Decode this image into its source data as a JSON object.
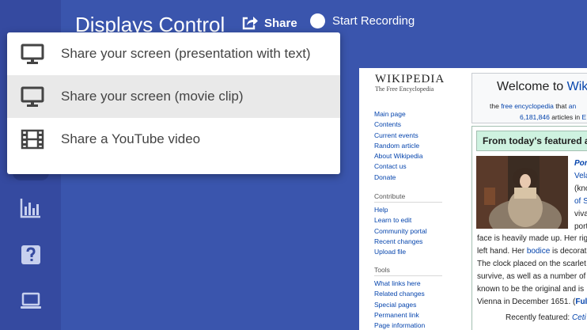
{
  "header": {
    "title": "Displays Control",
    "share_label": "Share",
    "recording_label": "Start Recording"
  },
  "sidebar": {
    "items": [
      {
        "icon": "bar-chart-icon"
      },
      {
        "icon": "help-icon"
      },
      {
        "icon": "laptop-icon"
      }
    ]
  },
  "share_menu": {
    "items": [
      {
        "label": "Share your screen (presentation with text)",
        "icon": "monitor-icon",
        "active": false
      },
      {
        "label": "Share your screen (movie clip)",
        "icon": "monitor-icon",
        "active": true
      },
      {
        "label": "Share a YouTube video",
        "icon": "film-icon",
        "active": false
      }
    ]
  },
  "preview": {
    "logo_name": "WIKIPEDIA",
    "logo_tagline": "The Free Encyclopedia",
    "nav_main": [
      "Main page",
      "Contents",
      "Current events",
      "Random article",
      "About Wikipedia",
      "Contact us",
      "Donate"
    ],
    "nav_contribute_head": "Contribute",
    "nav_contribute": [
      "Help",
      "Learn to edit",
      "Community portal",
      "Recent changes",
      "Upload file"
    ],
    "nav_tools_head": "Tools",
    "nav_tools": [
      "What links here",
      "Related changes",
      "Special pages",
      "Permanent link",
      "Page information"
    ],
    "welcome_prefix": "Welcome to ",
    "welcome_link": "Wik",
    "welcome_sub_prefix": "the ",
    "welcome_sub_link": "free encyclopedia",
    "welcome_sub_suffix": " that ",
    "welcome_sub_link2": "an",
    "welcome_count_link": "6,181,846",
    "welcome_count_suffix": " articles in ",
    "welcome_count_link2": "E",
    "featured_heading": "From today's featured a",
    "feat_links": [
      "Por",
      "Vela",
      "of S"
    ],
    "feat_side_text": [
      "(kno",
      "viva",
      "port"
    ],
    "feat_lines": [
      "face is heavily made up. Her rig",
      "left hand. Her ",
      "The clock placed on the scarlet",
      "survive, as well as a number of",
      "known to be the original and is",
      "Vienna in December 1651. ("
    ],
    "feat_bodice": "bodice",
    "feat_bodice_suffix": " is decorat",
    "feat_full": "Ful",
    "recently_featured_label": "Recently featured: ",
    "recently_featured_link": "Ceti"
  },
  "colors": {
    "background": "#3a55ad",
    "sidebar": "#354aa0",
    "menu_active": "#e9e9e9",
    "link": "#0645ad"
  }
}
